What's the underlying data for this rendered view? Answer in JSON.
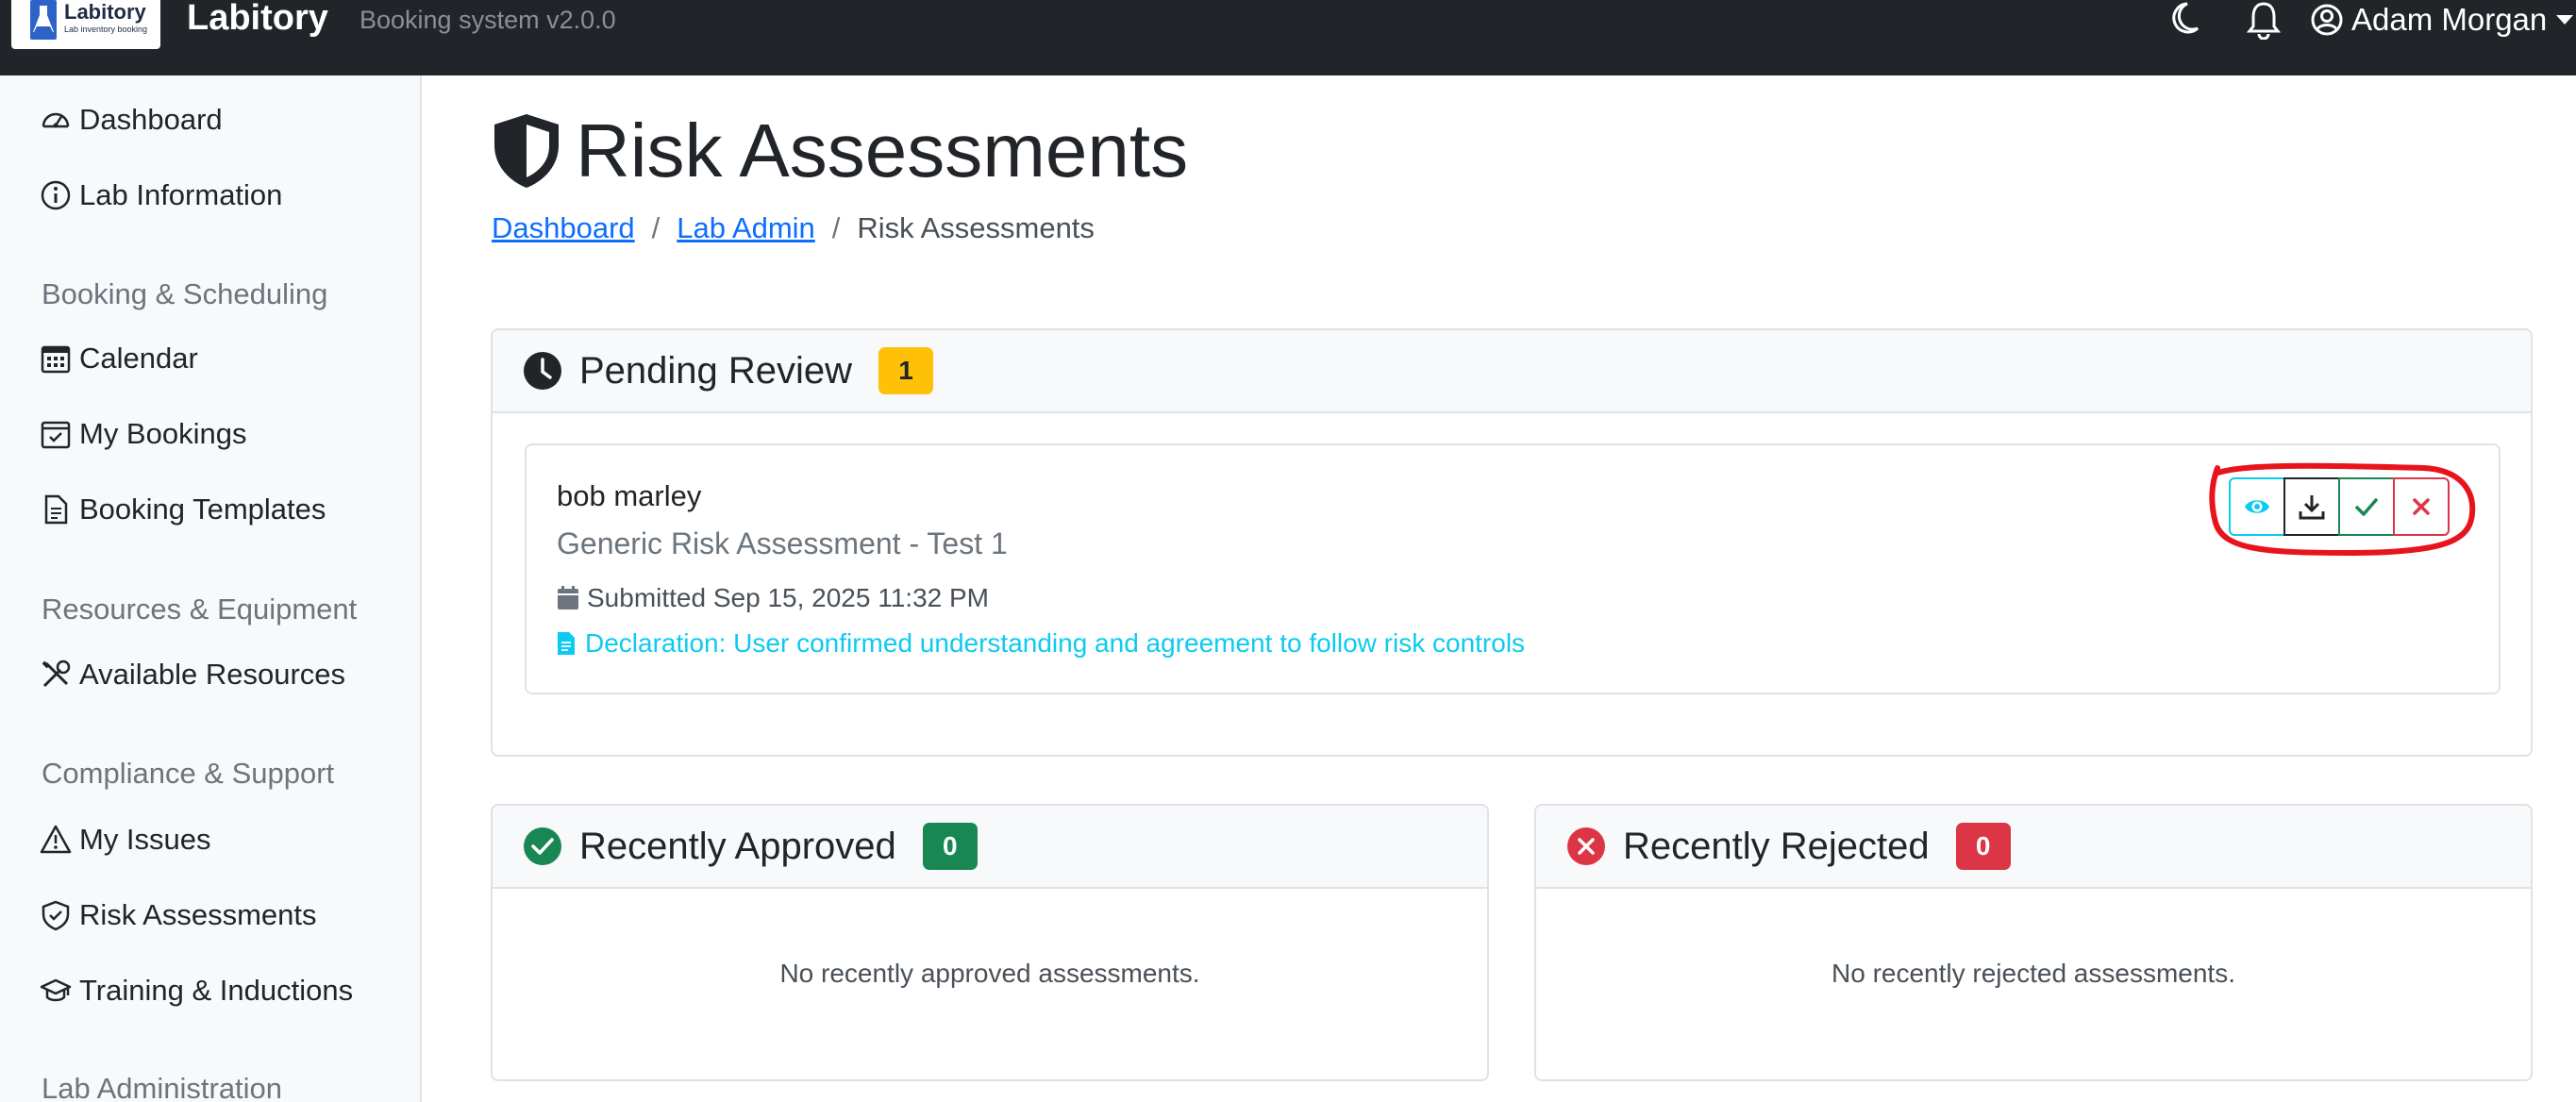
{
  "navbar": {
    "logo_title": "Labitory",
    "logo_subtitle": "Lab inventory booking",
    "brand": "Labitory",
    "brand_subtitle": "Booking system v2.0.0",
    "user_name": "Adam Morgan"
  },
  "sidebar": {
    "items": {
      "dashboard": "Dashboard",
      "lab_information": "Lab Information",
      "calendar": "Calendar",
      "my_bookings": "My Bookings",
      "booking_templates": "Booking Templates",
      "available_resources": "Available Resources",
      "my_issues": "My Issues",
      "risk_assessments": "Risk Assessments",
      "training_inductions": "Training & Inductions"
    },
    "headings": {
      "booking": "Booking & Scheduling",
      "resources": "Resources & Equipment",
      "compliance": "Compliance & Support",
      "lab_admin": "Lab Administration"
    }
  },
  "page": {
    "title": "Risk Assessments",
    "breadcrumb": {
      "dashboard": "Dashboard",
      "lab_admin": "Lab Admin",
      "current": "Risk Assessments"
    }
  },
  "pending": {
    "title": "Pending Review",
    "count": "1",
    "item": {
      "name": "bob marley",
      "assessment": "Generic Risk Assessment - Test 1",
      "submitted": "Submitted Sep 15, 2025 11:32 PM",
      "declaration": "Declaration: User confirmed understanding and agreement to follow risk controls"
    }
  },
  "approved": {
    "title": "Recently Approved",
    "count": "0",
    "empty": "No recently approved assessments."
  },
  "rejected": {
    "title": "Recently Rejected",
    "count": "0",
    "empty": "No recently rejected assessments."
  },
  "colors": {
    "navbar": "#212529",
    "primary_link": "#0d6efd",
    "info": "#0dcaf0",
    "success": "#198754",
    "danger": "#dc3545",
    "warning": "#ffc107",
    "annotation": "#e8141c"
  },
  "icons": {
    "moon": "moon-icon",
    "bell": "bell-icon",
    "user": "user-circle-icon",
    "view": "eye-icon",
    "download": "download-icon",
    "approve": "check-icon",
    "reject": "x-icon"
  }
}
